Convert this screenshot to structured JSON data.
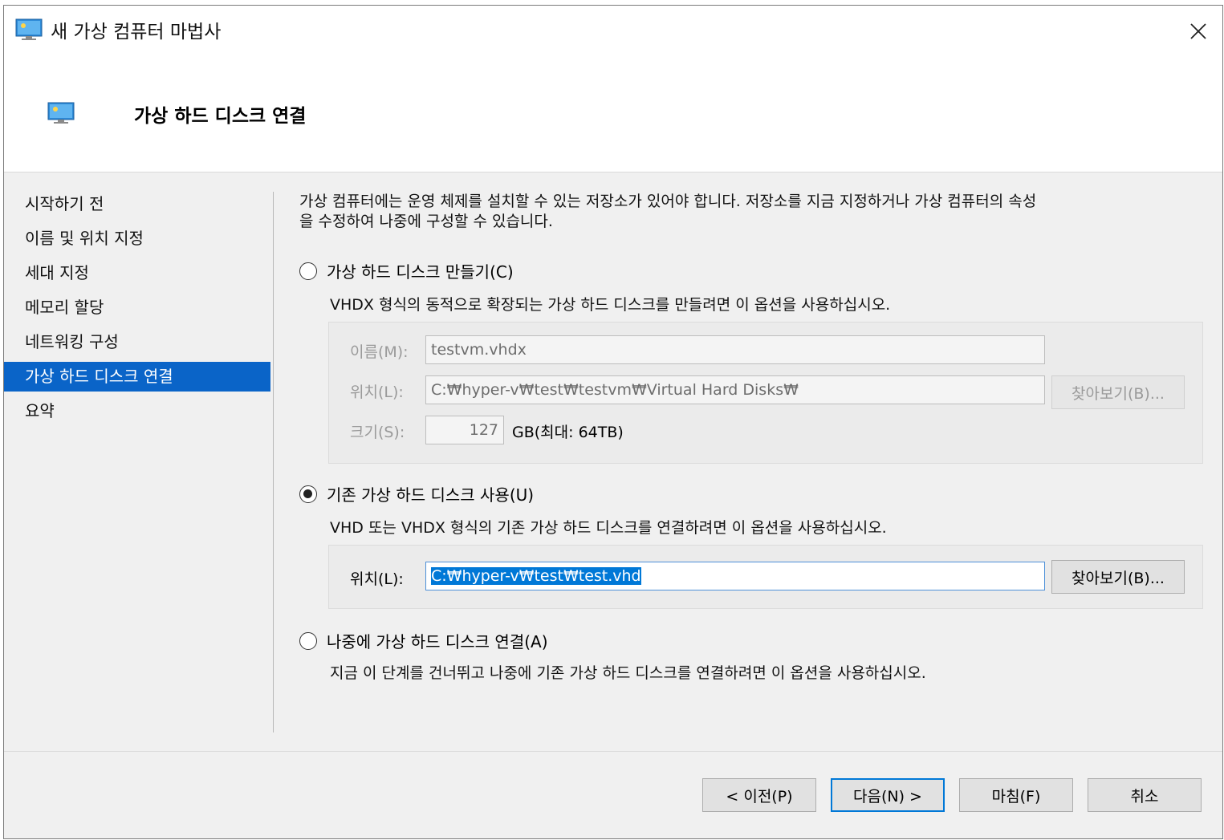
{
  "window": {
    "title": "새 가상 컴퓨터 마법사",
    "close_glyph": "✕"
  },
  "header": {
    "title": "가상 하드 디스크 연결"
  },
  "sidebar": {
    "items": [
      {
        "label": "시작하기 전"
      },
      {
        "label": "이름 및 위치 지정"
      },
      {
        "label": "세대 지정"
      },
      {
        "label": "메모리 할당"
      },
      {
        "label": "네트워킹 구성"
      },
      {
        "label": "가상 하드 디스크 연결",
        "active": true
      },
      {
        "label": "요약"
      }
    ]
  },
  "content": {
    "intro_line1": "가상 컴퓨터에는 운영 체제를 설치할 수 있는 저장소가 있어야 합니다. 저장소를 지금 지정하거나 가상 컴퓨터의 속성",
    "intro_line2": "을 수정하여 나중에 구성할 수 있습니다.",
    "create_option": {
      "label": "가상 하드 디스크 만들기(C)",
      "selected": false,
      "description": "VHDX 형식의 동적으로 확장되는 가상 하드 디스크를 만들려면 이 옵션을 사용하십시오.",
      "name_label": "이름(M):",
      "name_value": "testvm.vhdx",
      "location_label": "위치(L):",
      "location_value": "C:₩hyper-v₩test₩testvm₩Virtual Hard Disks₩",
      "browse_label": "찾아보기(B)...",
      "size_label": "크기(S):",
      "size_value": "127",
      "size_unit": "GB(최대: 64TB)"
    },
    "existing_option": {
      "label": "기존 가상 하드 디스크 사용(U)",
      "selected": true,
      "description": "VHD 또는 VHDX 형식의 기존 가상 하드 디스크를 연결하려면 이 옵션을 사용하십시오.",
      "location_label": "위치(L):",
      "location_value": "C:₩hyper-v₩test₩test.vhd",
      "browse_label": "찾아보기(B)..."
    },
    "later_option": {
      "label": "나중에 가상 하드 디스크 연결(A)",
      "selected": false,
      "description": "지금 이 단계를 건너뛰고 나중에 기존 가상 하드 디스크를 연결하려면 이 옵션을 사용하십시오."
    }
  },
  "footer": {
    "previous": "< 이전(P)",
    "next": "다음(N) >",
    "finish": "마침(F)",
    "cancel": "취소"
  },
  "colors": {
    "accent": "#0a64c8",
    "selection": "#0078d7",
    "background": "#f0f0f0"
  }
}
